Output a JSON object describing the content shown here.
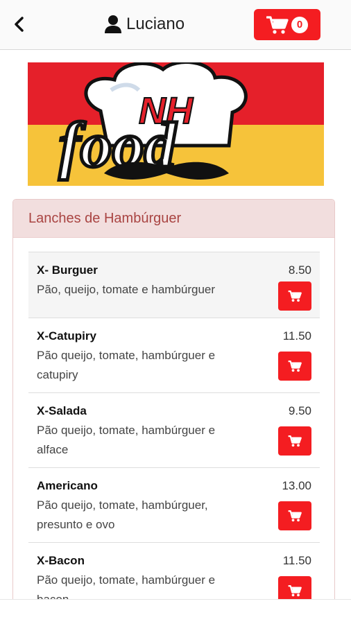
{
  "header": {
    "back_icon": "chevron-left-icon",
    "user_icon": "person-icon",
    "user_name": "Luciano",
    "cart_icon": "cart-icon",
    "cart_count": "0"
  },
  "banner": {
    "logo_text_top": "NH",
    "logo_text_bottom": "food"
  },
  "menu": {
    "category_title": "Lanches de Hambúrguer",
    "items": [
      {
        "name": "X- Burguer",
        "description": "Pão, queijo, tomate e hambúrguer",
        "price": "8.50"
      },
      {
        "name": "X-Catupiry",
        "description": "Pão queijo, tomate, hambúrguer e catupiry",
        "price": "11.50"
      },
      {
        "name": "X-Salada",
        "description": "Pão queijo, tomate, hambúrguer e alface",
        "price": "9.50"
      },
      {
        "name": "Americano",
        "description": "Pão queijo, tomate, hambúrguer, presunto e ovo",
        "price": "13.00"
      },
      {
        "name": "X-Bacon",
        "description": "Pão queijo, tomate, hambúrguer e bacon",
        "price": "11.50"
      }
    ]
  },
  "colors": {
    "accent": "#f41d21",
    "panel_heading_bg": "#f2dede",
    "panel_heading_text": "#a94442",
    "banner_red": "#e5202a",
    "banner_yellow": "#f6c33a"
  }
}
